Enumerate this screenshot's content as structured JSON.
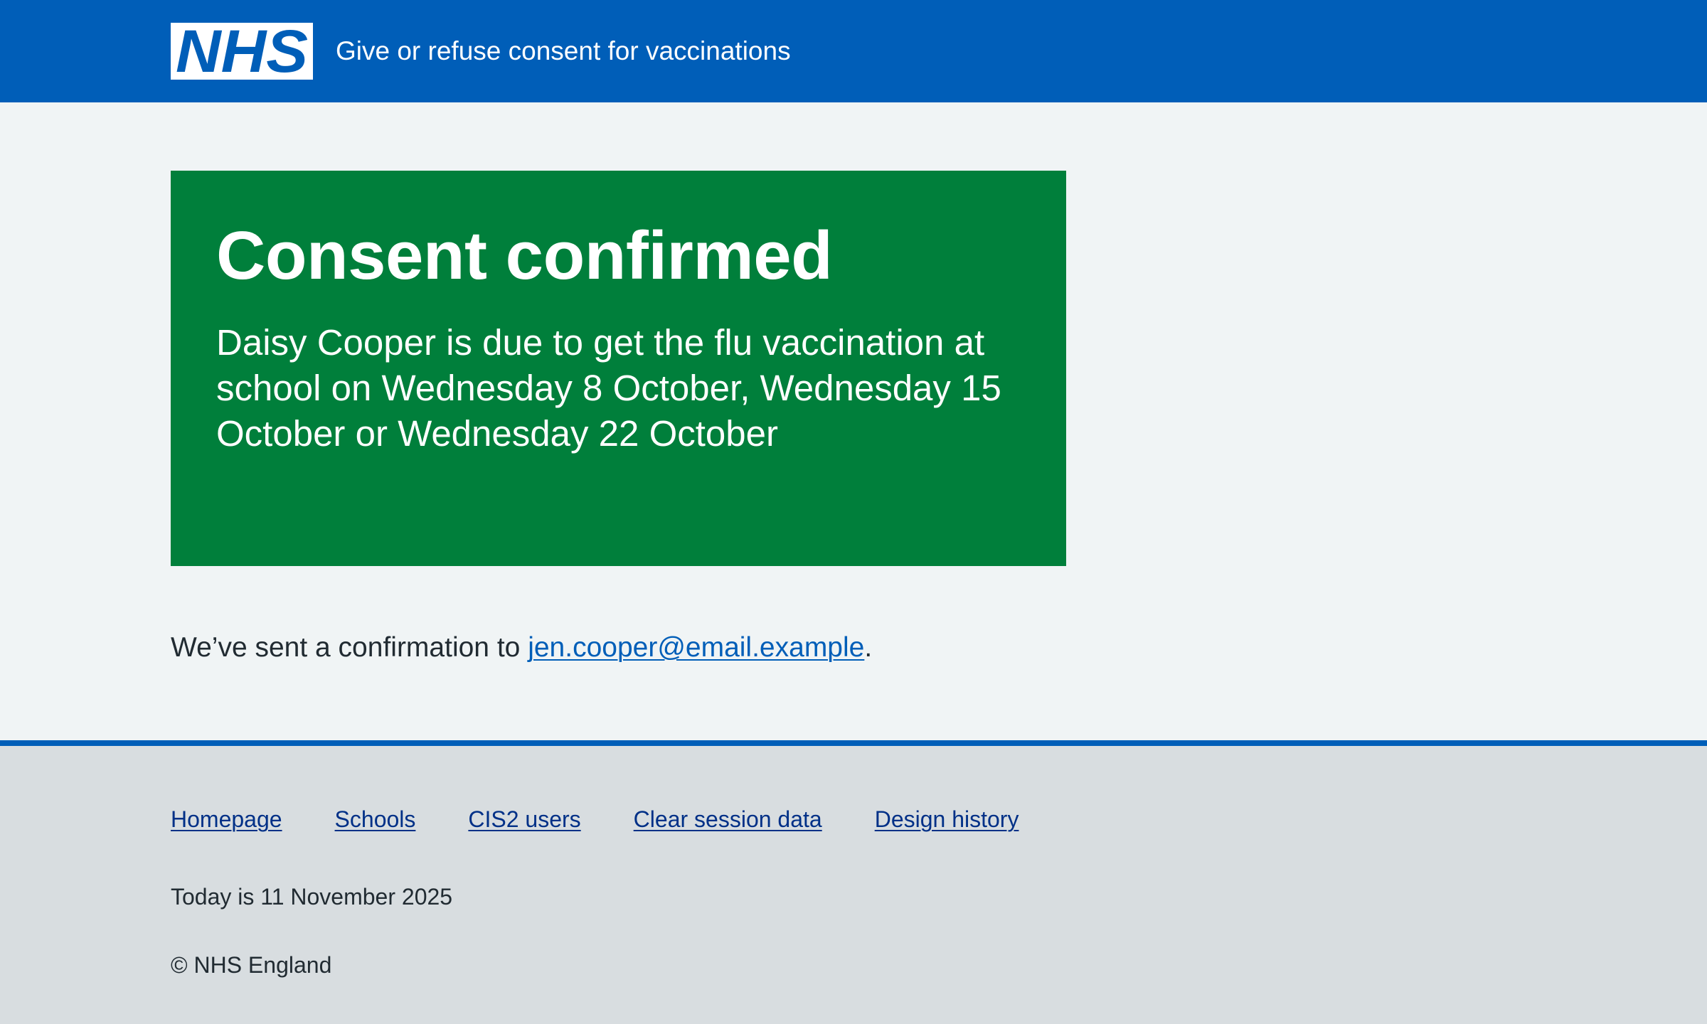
{
  "header": {
    "logo_text": "NHS",
    "service_name": "Give or refuse consent for vaccinations"
  },
  "panel": {
    "title": "Consent confirmed",
    "body": "Daisy Cooper is due to get the flu vaccination at school on Wednesday 8 October, Wednesday 15 October or Wednesday 22 October"
  },
  "confirmation": {
    "prefix": "We’ve sent a confirmation to ",
    "email": "jen.cooper@email.example",
    "suffix": "."
  },
  "footer": {
    "links": [
      {
        "label": "Homepage"
      },
      {
        "label": "Schools"
      },
      {
        "label": "CIS2 users"
      },
      {
        "label": "Clear session data"
      },
      {
        "label": "Design history"
      }
    ],
    "date_text": "Today is 11 November 2025",
    "copyright": "© NHS England"
  },
  "colors": {
    "header_blue": "#005eb8",
    "success_green": "#007f3b",
    "page_background": "#f0f4f5",
    "footer_background": "#d8dde0",
    "link_blue": "#005eb8",
    "footer_link": "#003087",
    "text": "#212b32"
  }
}
